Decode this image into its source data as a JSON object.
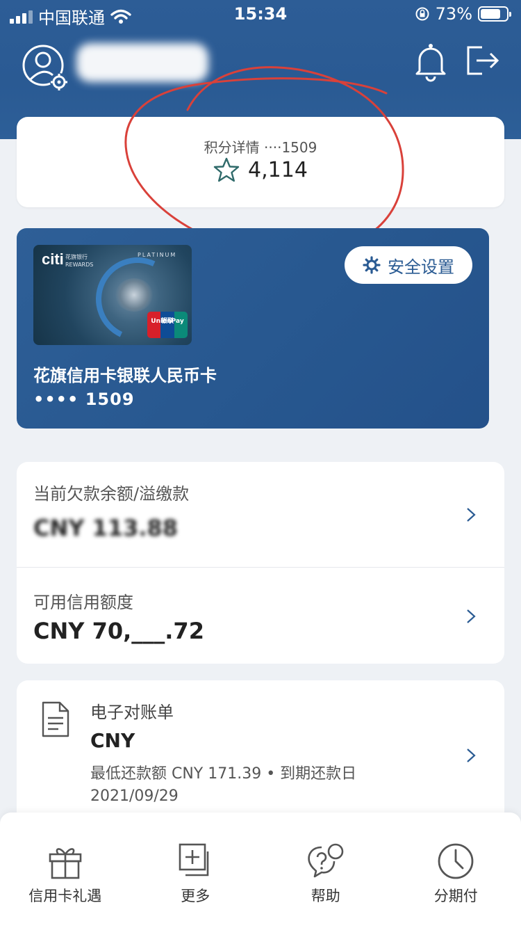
{
  "status_bar": {
    "carrier": "中国联通",
    "time": "15:34",
    "battery": "73%"
  },
  "header": {
    "username_hidden": true
  },
  "points": {
    "label": "积分详情 ····1509",
    "value": "4,114",
    "icon": "star-icon"
  },
  "card": {
    "name": "花旗信用卡银联人民币卡",
    "number": "•••• 1509",
    "security_label": "安全设置",
    "image_text": {
      "brand": "citi",
      "bank": "花旗银行",
      "program": "REWARDS",
      "tier": "PLATINUM",
      "network": "UnionPay",
      "network_cn": "银联"
    }
  },
  "balance": {
    "current_title": "当前欠款余额/溢缴款",
    "current_amount": "CNY  113.88",
    "available_title": "可用信用额度",
    "available_amount": "CNY 70,___.72"
  },
  "statement": {
    "title": "电子对账单",
    "amount": "CNY",
    "detail": "最低还款额 CNY 171.39 • 到期还款日",
    "due_date": "2021/09/29"
  },
  "tabs": [
    {
      "label": "信用卡礼遇",
      "icon": "gift-icon"
    },
    {
      "label": "更多",
      "icon": "more-plus-icon"
    },
    {
      "label": "帮助",
      "icon": "help-icon"
    },
    {
      "label": "分期付",
      "icon": "clock-icon"
    }
  ],
  "colors": {
    "header_blue": "#2d5d96",
    "annotation_red": "#d9413a",
    "icon_teal": "#2f6a6a"
  }
}
